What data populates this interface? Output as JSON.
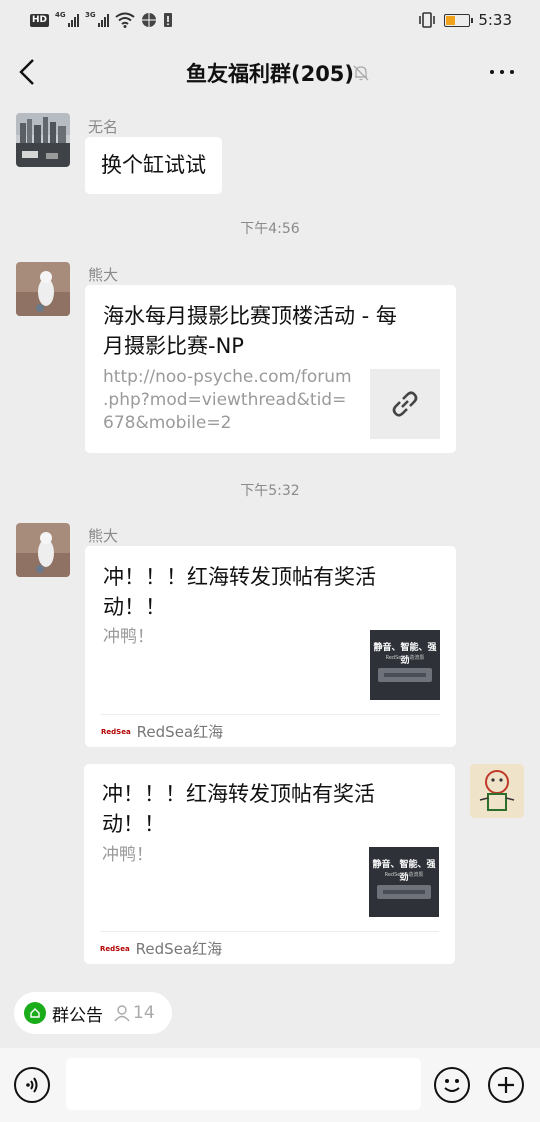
{
  "status_bar": {
    "hd": "HD",
    "net1": "4G",
    "net2": "3G",
    "time": "5:33",
    "battery_level": 0.35,
    "battery_color": "#f0a31a"
  },
  "header": {
    "title": "鱼友福利群(205)",
    "back_icon": "chevron-left-icon",
    "mute_icon": "bell-off-icon",
    "more_icon": "more-icon"
  },
  "messages": [
    {
      "sender": "无名",
      "text": "换个缸试试"
    },
    {
      "time": "下午4:56"
    },
    {
      "sender": "熊大",
      "card": {
        "title_line1": "海水每月摄影比赛顶楼活动 - 每",
        "title_line2": "月摄影比赛-NP",
        "desc_line1": "http://noo-psyche.com/forum",
        "desc_line2": ".php?mod=viewthread&tid=",
        "desc_line3": "678&mobile=2",
        "thumb_icon": "link-icon"
      }
    },
    {
      "time": "下午5:32"
    },
    {
      "sender": "熊大",
      "card": {
        "title_line1": "冲！！！红海转发顶帖有奖活",
        "title_line2": "动！！",
        "desc": "冲鸭！",
        "thumb_caption": "静音、智能、强劲",
        "thumb_sub": "RedSea®造流泵",
        "source": "RedSea红海",
        "source_logo": "RedSea"
      }
    },
    {
      "sender": "self",
      "card": {
        "title_line1": "冲！！！红海转发顶帖有奖活",
        "title_line2": "动！！",
        "desc": "冲鸭！",
        "thumb_caption": "静音、智能、强劲",
        "thumb_sub": "RedSea®造流泵",
        "source": "RedSea红海",
        "source_logo": "RedSea"
      }
    }
  ],
  "bottom": {
    "notice_label": "群公告",
    "notice_count": "14",
    "input_placeholder": "",
    "voice_icon": "voice-icon",
    "emoji_icon": "emoji-icon",
    "plus_icon": "plus-icon"
  }
}
